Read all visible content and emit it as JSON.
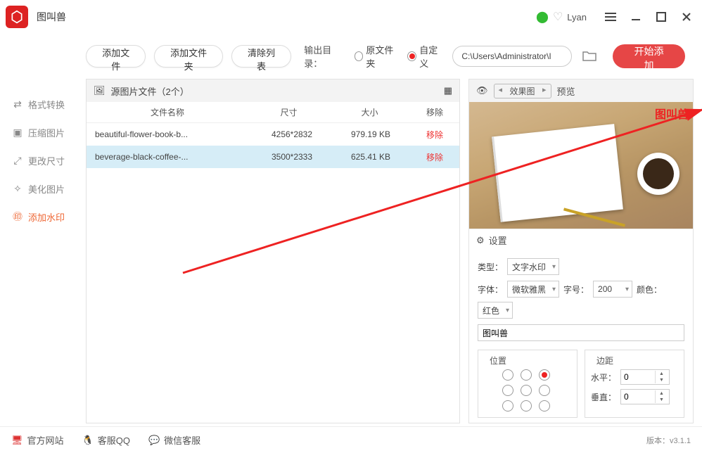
{
  "app": {
    "title": "图叫兽"
  },
  "user": {
    "name": "Lyan"
  },
  "sidebar": {
    "items": [
      {
        "label": "格式转换",
        "icon": "⇄"
      },
      {
        "label": "压缩图片",
        "icon": "▣"
      },
      {
        "label": "更改尺寸",
        "icon": "⤢"
      },
      {
        "label": "美化图片",
        "icon": "✧"
      },
      {
        "label": "添加水印",
        "icon": "㊞"
      }
    ]
  },
  "toolbar": {
    "add_file": "添加文件",
    "add_folder": "添加文件夹",
    "clear_list": "清除列表",
    "output_dir_label": "输出目录：",
    "radio_original": "原文件夹",
    "radio_custom": "自定义",
    "path_value": "C:\\Users\\Administrator\\I",
    "start": "开始添加"
  },
  "file_panel": {
    "header": "源图片文件（2个）",
    "columns": {
      "name": "文件名称",
      "dim": "尺寸",
      "size": "大小",
      "remove": "移除"
    },
    "rows": [
      {
        "name": "beautiful-flower-book-b...",
        "dim": "4256*2832",
        "size": "979.19 KB",
        "remove": "移除"
      },
      {
        "name": "beverage-black-coffee-...",
        "dim": "3500*2333",
        "size": "625.41 KB",
        "remove": "移除"
      }
    ]
  },
  "preview": {
    "mode": "效果图",
    "label": "预览",
    "watermark_sample": "图叫兽"
  },
  "settings": {
    "header": "设置",
    "type_label": "类型：",
    "type_value": "文字水印",
    "font_label": "字体：",
    "font_value": "微软雅黑",
    "size_label": "字号：",
    "size_value": "200",
    "color_label": "颜色：",
    "color_value": "红色",
    "text_value": "图叫兽",
    "position_title": "位置",
    "margin_title": "边距",
    "h_label": "水平：",
    "h_value": "0",
    "v_label": "垂直：",
    "v_value": "0"
  },
  "footer": {
    "site": "官方网站",
    "qq": "客服QQ",
    "wechat": "微信客服",
    "version": "版本：v3.1.1"
  }
}
